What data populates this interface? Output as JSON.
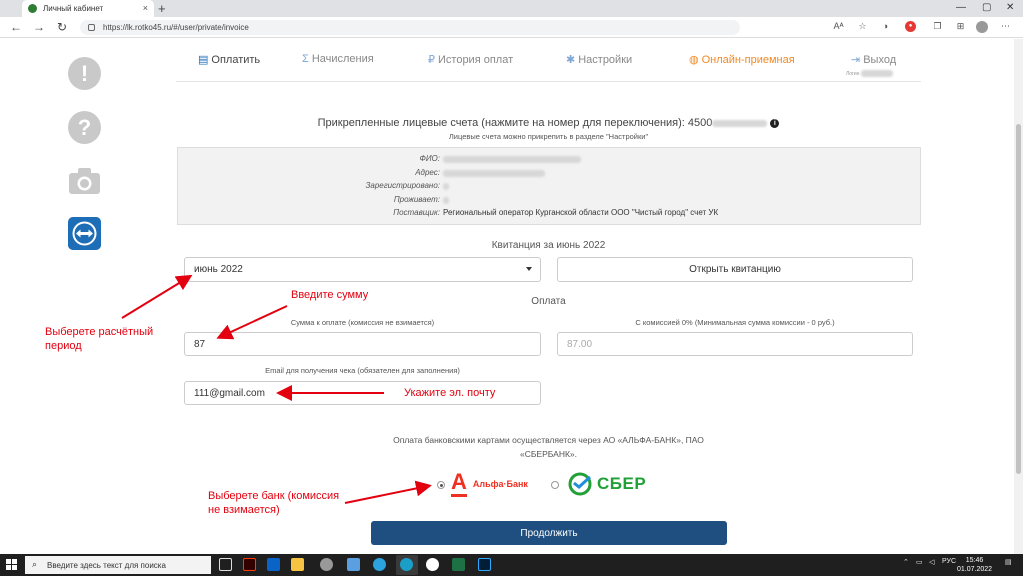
{
  "browser": {
    "tab_title": "Личный кабинет",
    "url": "https://lk.rotko45.ru/#/user/private/invoice",
    "new_tab": "+",
    "tab_close": "×",
    "reader_mode": "Aᴬ"
  },
  "nav": {
    "items": [
      {
        "label": "Оплатить",
        "icon": "receipt-icon",
        "glyph": "▤"
      },
      {
        "label": "Начисления",
        "icon": "sigma-icon",
        "glyph": "Σ"
      },
      {
        "label": "История оплат",
        "icon": "ruble-icon",
        "glyph": "₽"
      },
      {
        "label": "Настройки",
        "icon": "gear-icon",
        "glyph": "✱"
      },
      {
        "label": "Онлайн-приемная",
        "icon": "chat-icon",
        "glyph": "◍"
      },
      {
        "label": "Выход",
        "icon": "logout-icon",
        "glyph": "⇥"
      }
    ],
    "login_label": "Логин"
  },
  "accounts": {
    "line": "Прикрепленные лицевые счета (нажмите на номер для переключения): 4500",
    "sub": "Лицевые счета можно прикрепить в разделе \"Настройки\""
  },
  "info": {
    "rows": [
      {
        "label": "ФИО:",
        "value": ""
      },
      {
        "label": "Адрес:",
        "value": ""
      },
      {
        "label": "Зарегистрировано:",
        "value": ""
      },
      {
        "label": "Проживает:",
        "value": ""
      },
      {
        "label": "Поставщик:",
        "value": "Региональный оператор Курганской области ООО \"Чистый город\" счет УК"
      }
    ]
  },
  "invoice": {
    "title": "Квитанция за июнь 2022",
    "period_value": "июнь 2022",
    "open_button": "Открыть квитанцию"
  },
  "payment": {
    "title": "Оплата",
    "amount_label": "Сумма к оплате (комиссия не взимается)",
    "amount_value": "87",
    "commission_label": "С комиссией 0% (Минимальная сумма комиссии - 0 руб.)",
    "commission_value": "87.00",
    "email_label": "Email для получения чека (обязателен для заполнения)",
    "email_value": "111@gmail.com",
    "bank_text": "Оплата банковскими картами осуществляется через АО «АЛЬФА-БАНК», ПАО «СБЕРБАНК».",
    "alfa_name": "Альфа·Банк",
    "alfa_letter": "А",
    "sber_name": "СБЕР",
    "continue_button": "Продолжить"
  },
  "annotations": {
    "period": "Выберете расчётный период",
    "amount": "Введите сумму",
    "email": "Укажите эл. почту",
    "bank": "Выберете банк (комиссия не взимается)"
  },
  "taskbar": {
    "search_placeholder": "Введите здесь текст для поиска",
    "lang": "РУС",
    "time": "15:46",
    "date": "01.07.2022"
  },
  "colors": {
    "annotation": "#e3000f",
    "primary_button": "#1f4f80",
    "accent_orange": "#f08a24",
    "alfa_red": "#ef3124",
    "sber_green": "#21a038"
  }
}
